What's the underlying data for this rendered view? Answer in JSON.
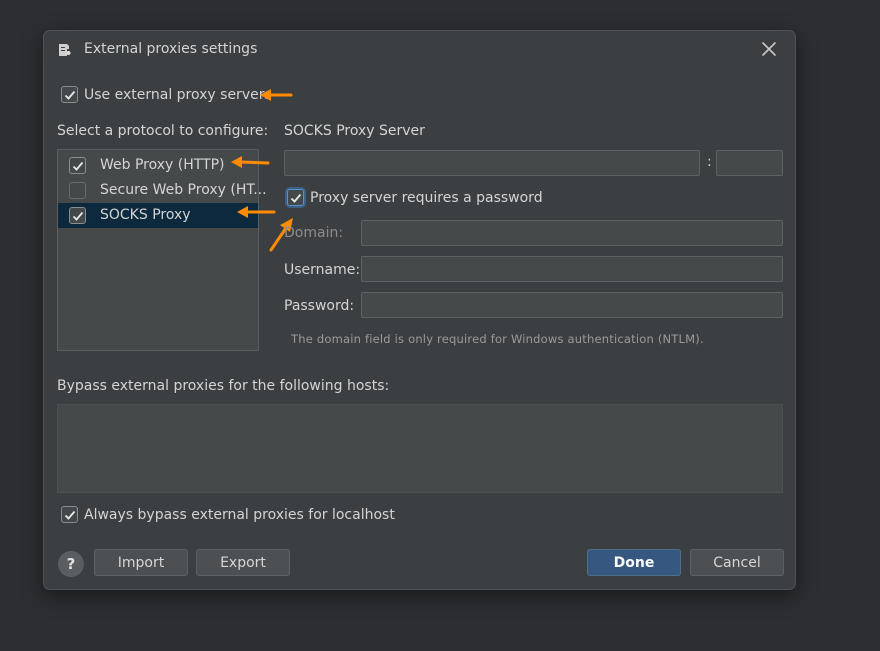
{
  "dialog": {
    "title": "External proxies settings",
    "use_external": {
      "label": "Use external proxy servers",
      "checked": true
    },
    "protocol_label": "Select a protocol to configure:",
    "protocols": [
      {
        "label": "Web Proxy (HTTP)",
        "checked": true,
        "selected": false
      },
      {
        "label": "Secure Web Proxy (HT...",
        "checked": false,
        "selected": false
      },
      {
        "label": "SOCKS Proxy",
        "checked": true,
        "selected": true
      }
    ],
    "server_heading": "SOCKS Proxy Server",
    "server": {
      "host_value": "",
      "port_separator": ":",
      "port_value": ""
    },
    "requires_password": {
      "label": "Proxy server requires a password",
      "checked": true
    },
    "domain_label": "Domain:",
    "username_label": "Username:",
    "password_label": "Password:",
    "domain_value": "",
    "username_value": "",
    "password_value": "",
    "hint": "The domain field is only required for Windows authentication (NTLM).",
    "bypass_label": "Bypass external proxies for the following hosts:",
    "bypass_value": "",
    "localhost": {
      "label": "Always bypass external proxies for localhost",
      "checked": true
    },
    "buttons": {
      "help": "?",
      "import": "Import",
      "export": "Export",
      "done": "Done",
      "cancel": "Cancel"
    }
  },
  "colors": {
    "accent_arrow": "#ff8c00",
    "primary_button": "#365880",
    "selection": "#0d293e"
  },
  "icons": [
    "app-icon",
    "close-icon",
    "check-icon",
    "help-icon",
    "annotation-arrow-icon"
  ]
}
